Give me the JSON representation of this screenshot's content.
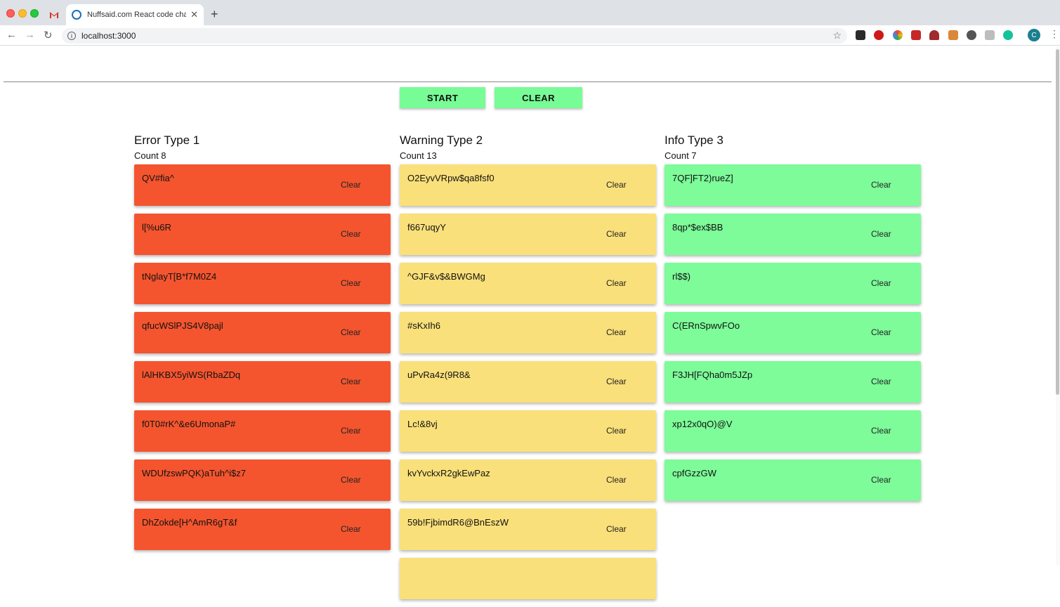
{
  "browser": {
    "tab_title": "Nuffsaid.com React code chall",
    "url": "localhost:3000",
    "avatar_letter": "C"
  },
  "controls": {
    "start_label": "START",
    "clear_label": "CLEAR"
  },
  "columns": [
    {
      "title": "Error Type 1",
      "count": "Count 8",
      "color": "#f4552f",
      "messages": [
        "QV#fia^",
        "l[%u6R",
        "tNglayT[B*f7M0Z4",
        "qfucWSlPJS4V8pajl",
        "lAlHKBX5yiWS(RbaZDq",
        "f0T0#rK^&e6UmonaP#",
        "WDUfzswPQK)aTuh^i$z7",
        "DhZokde[H^AmR6gT&f"
      ]
    },
    {
      "title": "Warning Type 2",
      "count": "Count 13",
      "color": "#fae07a",
      "messages": [
        "O2EyvVRpw$qa8fsf0",
        "f667uqyY",
        "^GJF&v$&BWGMg",
        "#sKxIh6",
        "uPvRa4z(9R8&",
        "Lc!&8vj",
        "kvYvckxR2gkEwPaz",
        "59b!FjbimdR6@BnEszW",
        ""
      ]
    },
    {
      "title": "Info Type 3",
      "count": "Count 7",
      "color": "#7dfc99",
      "messages": [
        "7QF]FT2)rueZ]",
        "8qp*$ex$BB",
        "rl$$)",
        "C(ERnSpwvFOo",
        "F3JH[FQha0m5JZp",
        "xp12x0qO)@V",
        "cpfGzzGW"
      ]
    }
  ],
  "card_clear_label": "Clear"
}
